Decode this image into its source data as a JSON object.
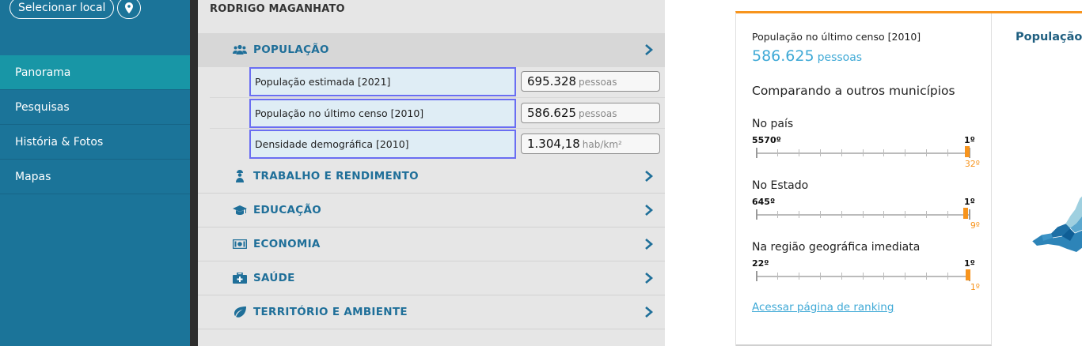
{
  "sidebar": {
    "select_location_label": "Selecionar local",
    "pin_icon": "map-pin-icon",
    "nav": [
      {
        "label": "Panorama",
        "active": true
      },
      {
        "label": "Pesquisas",
        "active": false
      },
      {
        "label": "História & Fotos",
        "active": false
      },
      {
        "label": "Mapas",
        "active": false
      }
    ]
  },
  "panel": {
    "municipality": "RODRIGO MAGANHATO",
    "sections": [
      {
        "label": "POPULAÇÃO",
        "icon": "people-icon",
        "open": true
      },
      {
        "label": "TRABALHO E RENDIMENTO",
        "icon": "worker-icon",
        "open": false
      },
      {
        "label": "EDUCAÇÃO",
        "icon": "graduation-cap-icon",
        "open": false
      },
      {
        "label": "ECONOMIA",
        "icon": "money-icon",
        "open": false
      },
      {
        "label": "SAÚDE",
        "icon": "medical-kit-icon",
        "open": false
      },
      {
        "label": "TERRITÓRIO E AMBIENTE",
        "icon": "leaf-icon",
        "open": false
      }
    ],
    "population_rows": [
      {
        "label": "População estimada [2021]",
        "value": "695.328",
        "unit": "pessoas"
      },
      {
        "label": "População no último censo [2010]",
        "value": "586.625",
        "unit": "pessoas"
      },
      {
        "label": "Densidade demográfica [2010]",
        "value": "1.304,18",
        "unit": "hab/km²"
      }
    ]
  },
  "card": {
    "title": "População no último censo [2010]",
    "value": "586.625",
    "unit": "pessoas",
    "compare_heading": "Comparando a outros municípios",
    "rankings": [
      {
        "label": "No país",
        "min": "5570º",
        "max": "1º",
        "position": "32º",
        "fraction": 0.9944
      },
      {
        "label": "No Estado",
        "min": "645º",
        "max": "1º",
        "position": "9º",
        "fraction": 0.9876
      },
      {
        "label": "Na região geográfica imediata",
        "min": "22º",
        "max": "1º",
        "position": "1º",
        "fraction": 1.0
      }
    ],
    "ranking_link": "Acessar página de ranking",
    "right_title": "População",
    "accent_color": "#f7941d",
    "link_color": "#3fa9d6"
  }
}
